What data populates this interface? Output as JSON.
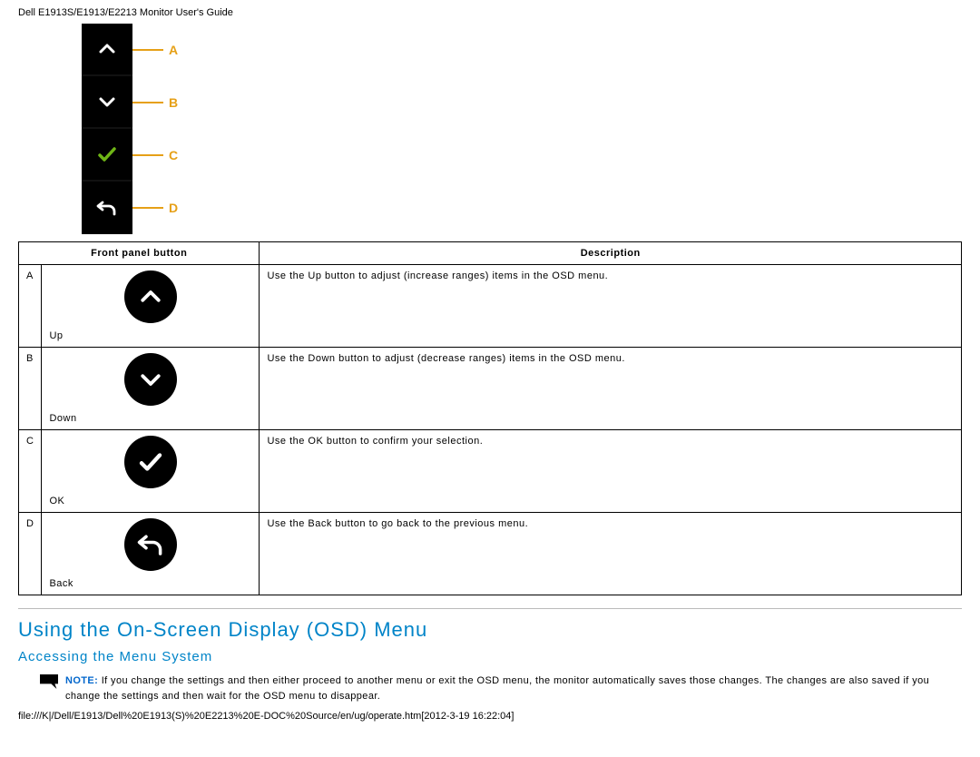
{
  "header": {
    "title": "Dell E1913S/E1913/E2213 Monitor User's Guide"
  },
  "strip": {
    "labels": [
      "A",
      "B",
      "C",
      "D"
    ]
  },
  "table": {
    "head": {
      "col1": "Front panel button",
      "col2": "Description"
    },
    "rows": [
      {
        "letter": "A",
        "name": "Up",
        "desc": "Use the Up button to adjust (increase ranges) items in the OSD menu."
      },
      {
        "letter": "B",
        "name": "Down",
        "desc": "Use the Down button to adjust (decrease ranges) items in the OSD menu."
      },
      {
        "letter": "C",
        "name": "OK",
        "desc": "Use the OK button to confirm your selection."
      },
      {
        "letter": "D",
        "name": "Back",
        "desc": "Use the Back button to go back to the previous menu."
      }
    ]
  },
  "section": {
    "heading": "Using the On-Screen Display (OSD) Menu",
    "subheading": "Accessing the Menu System"
  },
  "note": {
    "label": "NOTE:",
    "text": " If you change the settings and then either proceed to another menu or exit the OSD menu, the monitor automatically saves those changes. The changes are also saved if you change the settings and then wait for the OSD menu to disappear."
  },
  "footer": {
    "path": "file:///K|/Dell/E1913/Dell%20E1913(S)%20E2213%20E-DOC%20Source/en/ug/operate.htm[2012-3-19 16:22:04]"
  }
}
